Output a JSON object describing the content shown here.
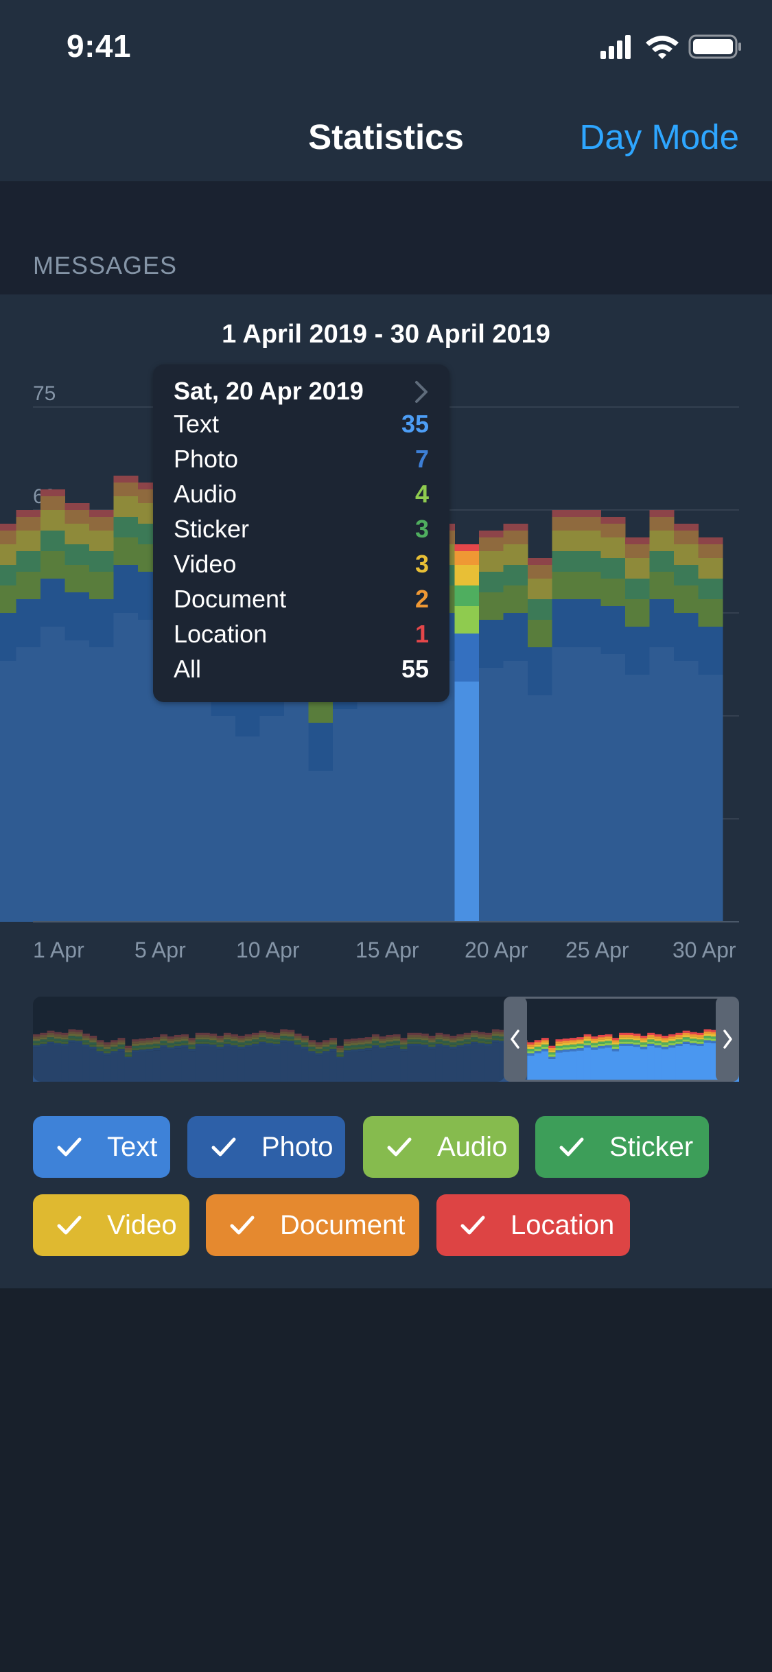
{
  "status_bar": {
    "time": "9:41"
  },
  "nav": {
    "title": "Statistics",
    "action": "Day Mode"
  },
  "section": {
    "header": "MESSAGES"
  },
  "chart": {
    "range_title": "1 April 2019 - 30 April 2019"
  },
  "tooltip": {
    "date": "Sat, 20 Apr 2019",
    "rows": [
      {
        "label": "Text",
        "value": "35",
        "color": "#4d9ef6"
      },
      {
        "label": "Photo",
        "value": "7",
        "color": "#3d7fd6"
      },
      {
        "label": "Audio",
        "value": "4",
        "color": "#8fcb4f"
      },
      {
        "label": "Sticker",
        "value": "3",
        "color": "#4fae5f"
      },
      {
        "label": "Video",
        "value": "3",
        "color": "#e8bf36"
      },
      {
        "label": "Document",
        "value": "2",
        "color": "#ef9834"
      },
      {
        "label": "Location",
        "value": "1",
        "color": "#e5474a"
      },
      {
        "label": "All",
        "value": "55",
        "color": "#ffffff"
      }
    ]
  },
  "filters": [
    {
      "label": "Text",
      "color": "#3e82d8"
    },
    {
      "label": "Photo",
      "color": "#2d60a8"
    },
    {
      "label": "Audio",
      "color": "#86bb4e"
    },
    {
      "label": "Sticker",
      "color": "#3d9e59"
    },
    {
      "label": "Video",
      "color": "#dfb930"
    },
    {
      "label": "Document",
      "color": "#e5892f"
    },
    {
      "label": "Location",
      "color": "#dd4444"
    }
  ],
  "chart_data": {
    "type": "bar",
    "stacked": true,
    "selected_index": 19,
    "y_ticks": [
      0,
      15,
      30,
      45,
      60,
      75
    ],
    "ylim": [
      0,
      75
    ],
    "x_tick_labels": [
      "1 Apr",
      "5 Apr",
      "10 Apr",
      "15 Apr",
      "20 Apr",
      "25 Apr",
      "30 Apr"
    ],
    "categories": [
      "1 Apr",
      "2 Apr",
      "3 Apr",
      "4 Apr",
      "5 Apr",
      "6 Apr",
      "7 Apr",
      "8 Apr",
      "9 Apr",
      "10 Apr",
      "11 Apr",
      "12 Apr",
      "13 Apr",
      "14 Apr",
      "15 Apr",
      "16 Apr",
      "17 Apr",
      "18 Apr",
      "19 Apr",
      "20 Apr",
      "21 Apr",
      "22 Apr",
      "23 Apr",
      "24 Apr",
      "25 Apr",
      "26 Apr",
      "27 Apr",
      "28 Apr",
      "29 Apr",
      "30 Apr"
    ],
    "series": [
      {
        "name": "Text",
        "color": "#2f5b92",
        "values": [
          38,
          40,
          43,
          41,
          40,
          45,
          44,
          39,
          36,
          30,
          27,
          30,
          33,
          22,
          31,
          32,
          33,
          34,
          38,
          35,
          37,
          38,
          33,
          40,
          40,
          39,
          36,
          40,
          38,
          36
        ]
      },
      {
        "name": "Photo",
        "color": "#24538d",
        "values": [
          7,
          7,
          7,
          7,
          7,
          7,
          7,
          7,
          7,
          7,
          7,
          7,
          7,
          7,
          7,
          7,
          7,
          7,
          7,
          7,
          7,
          7,
          7,
          7,
          7,
          7,
          7,
          7,
          7,
          7
        ]
      },
      {
        "name": "Audio",
        "color": "#597d3c",
        "values": [
          4,
          4,
          4,
          4,
          4,
          4,
          4,
          4,
          4,
          4,
          4,
          4,
          4,
          4,
          4,
          4,
          4,
          4,
          4,
          4,
          4,
          4,
          4,
          4,
          4,
          4,
          4,
          4,
          4,
          4
        ]
      },
      {
        "name": "Sticker",
        "color": "#3c7a57",
        "values": [
          3,
          3,
          3,
          3,
          3,
          3,
          3,
          3,
          3,
          3,
          3,
          3,
          3,
          3,
          3,
          3,
          3,
          3,
          3,
          3,
          3,
          3,
          3,
          3,
          3,
          3,
          3,
          3,
          3,
          3
        ]
      },
      {
        "name": "Video",
        "color": "#8e8a3a",
        "values": [
          3,
          3,
          3,
          3,
          3,
          3,
          3,
          3,
          3,
          3,
          3,
          3,
          3,
          3,
          3,
          3,
          3,
          3,
          3,
          3,
          3,
          3,
          3,
          3,
          3,
          3,
          3,
          3,
          3,
          3
        ]
      },
      {
        "name": "Document",
        "color": "#8f6a3e",
        "values": [
          2,
          2,
          2,
          2,
          2,
          2,
          2,
          2,
          2,
          2,
          2,
          2,
          2,
          2,
          2,
          2,
          2,
          2,
          2,
          2,
          2,
          2,
          2,
          2,
          2,
          2,
          2,
          2,
          2,
          2
        ]
      },
      {
        "name": "Location",
        "color": "#8d4449",
        "values": [
          1,
          1,
          1,
          1,
          1,
          1,
          1,
          1,
          1,
          1,
          1,
          1,
          1,
          1,
          1,
          1,
          1,
          1,
          1,
          1,
          1,
          1,
          1,
          1,
          1,
          1,
          1,
          1,
          1,
          1
        ]
      }
    ],
    "selected_colors": [
      "#4a90e2",
      "#3470c0",
      "#8fcb4f",
      "#4fae5f",
      "#e8bf36",
      "#ef9834",
      "#e5474a"
    ]
  }
}
